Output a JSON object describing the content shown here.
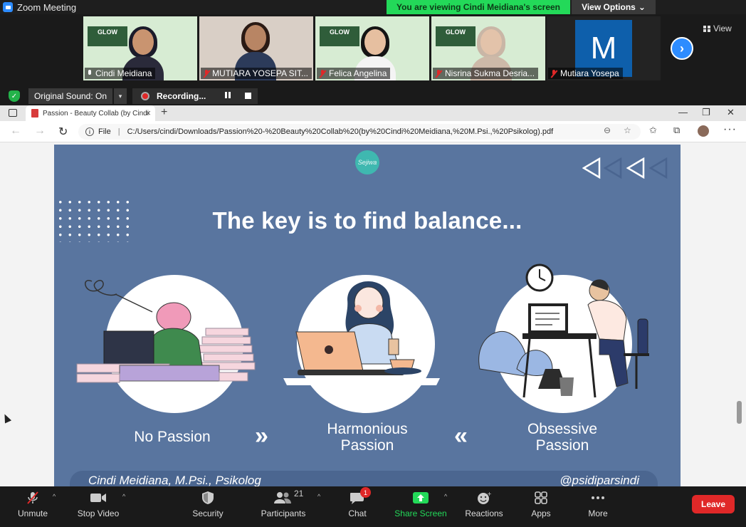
{
  "window": {
    "title": "Zoom Meeting"
  },
  "banner": {
    "viewing": "You are viewing Cindi Meidiana's screen",
    "view_options": "View Options"
  },
  "gallery": {
    "view_label": "View",
    "tiles": [
      {
        "name": "Cindi Meidiana",
        "muted": false
      },
      {
        "name": "MUTIARA YOSEPA SIT...",
        "muted": true
      },
      {
        "name": "Felica Angelina",
        "muted": true
      },
      {
        "name": "Nisrina Sukma Desria...",
        "muted": true
      },
      {
        "name": "Mutiara Yosepa",
        "muted": true,
        "avatar_letter": "M"
      }
    ],
    "slide_badge": "GLOW"
  },
  "sound": {
    "original_sound": "Original Sound: On",
    "recording": "Recording..."
  },
  "browser": {
    "tab_title": "Passion - Beauty Collab (by Cindi",
    "file_label": "File",
    "url": "C:/Users/cindi/Downloads/Passion%20-%20Beauty%20Collab%20(by%20Cindi%20Meidiana,%20M.Psi.,%20Psikolog).pdf"
  },
  "slide": {
    "logo_text": "Sejiwa",
    "title": "The key is to find balance...",
    "labels": {
      "no_passion": "No Passion",
      "harmonious_line1": "Harmonious",
      "harmonious_line2": "Passion",
      "obsessive_line1": "Obsessive",
      "obsessive_line2": "Passion"
    },
    "footer_left": "Cindi Meidiana, M.Psi., Psikolog",
    "footer_right": "@psidiparsindi"
  },
  "toolbar": {
    "unmute": "Unmute",
    "stop_video": "Stop Video",
    "security": "Security",
    "participants": "Participants",
    "participants_count": "21",
    "chat": "Chat",
    "chat_badge": "1",
    "share_screen": "Share Screen",
    "reactions": "Reactions",
    "apps": "Apps",
    "more": "More",
    "leave": "Leave"
  },
  "colors": {
    "zoom_blue": "#2d8cff",
    "banner_green": "#23d959",
    "slide_blue": "#59759f",
    "leave_red": "#e02828"
  }
}
